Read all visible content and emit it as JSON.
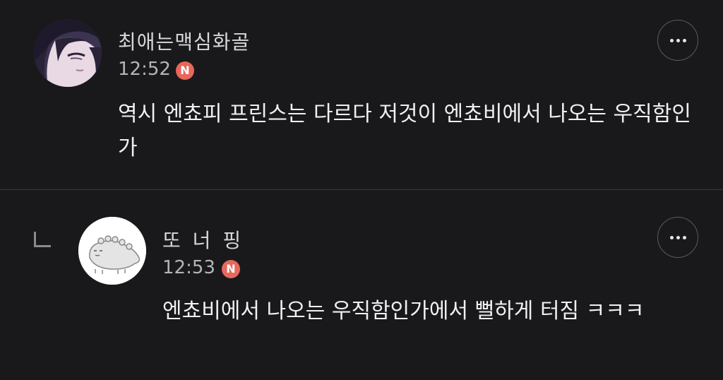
{
  "comments": [
    {
      "author": "최애는맥심화골",
      "time": "12:52",
      "badge": "N",
      "body": "역시 엔쵸피 프린스는 다르다 저것이 엔쵸비에서 나오는 우직함인가",
      "avatar_icon": "anime-portrait-avatar",
      "more_icon": "more-dots-icon"
    },
    {
      "author": "또 너 핑",
      "time": "12:53",
      "badge": "N",
      "body": "엔쵸비에서 나오는 우직함인가에서 뻘하게 터짐 ㅋㅋㅋ",
      "avatar_icon": "cartoon-creature-avatar",
      "more_icon": "more-dots-icon",
      "is_reply": true
    }
  ],
  "colors": {
    "background": "#19191b",
    "badge": "#e8675b",
    "divider": "#3a3a3e"
  }
}
